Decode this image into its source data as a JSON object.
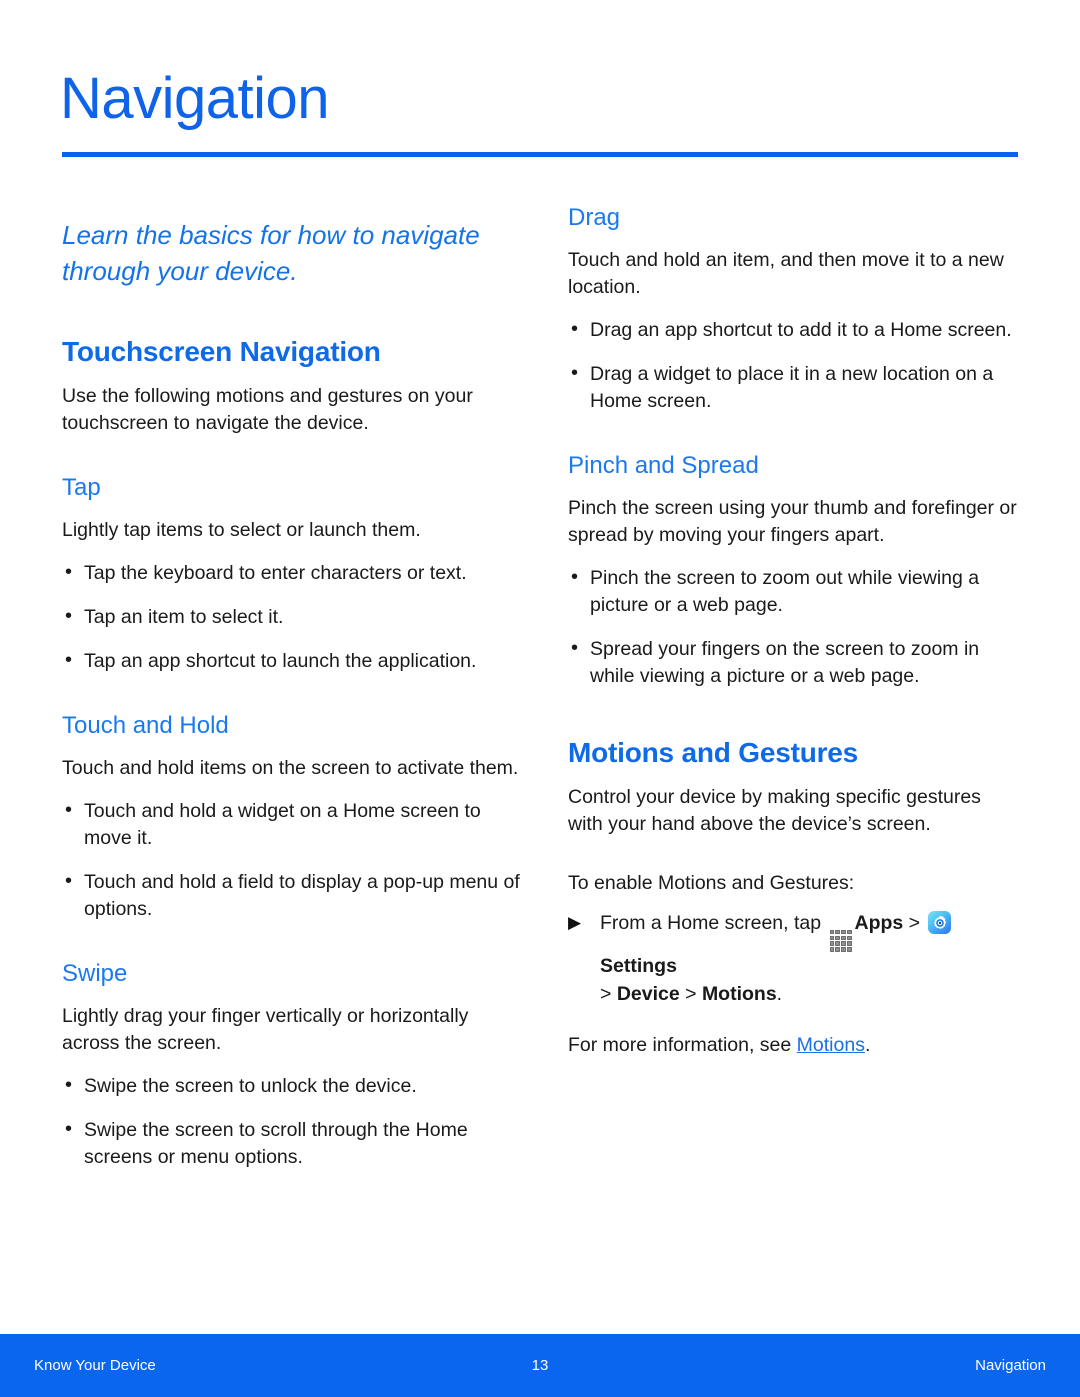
{
  "header": {
    "title": "Navigation",
    "rule_color": "#0a63ed"
  },
  "colors": {
    "accent_blue": "#0f63e8",
    "heading_blue": "#0f6ae8",
    "subheading_blue": "#1b79f0",
    "link_blue": "#1b6fe8",
    "footer_blue": "#0a66ee",
    "body_text": "#1a1a1a"
  },
  "left_column": {
    "intro": "Learn the basics for how to navigate through your device.",
    "section": {
      "title": "Touchscreen Navigation",
      "body": "Use the following motions and gestures on your touchscreen to navigate the device."
    },
    "subsections": [
      {
        "title": "Tap",
        "body": "Lightly tap items to select or launch them.",
        "bullets": [
          "Tap the keyboard to enter characters or text.",
          "Tap an item to select it.",
          "Tap an app shortcut to launch the application."
        ]
      },
      {
        "title": "Touch and Hold",
        "body": "Touch and hold items on the screen to activate them.",
        "bullets": [
          "Touch and hold a widget on a Home screen to move it.",
          "Touch and hold a field to display a pop-up menu of options."
        ]
      },
      {
        "title": "Swipe",
        "body": "Lightly drag your finger vertically or horizontally across the screen.",
        "bullets": [
          "Swipe the screen to unlock the device.",
          "Swipe the screen to scroll through the Home screens or menu options."
        ]
      }
    ]
  },
  "right_column": {
    "subsections": [
      {
        "title": "Drag",
        "body": "Touch and hold an item, and then move it to a new location.",
        "bullets": [
          "Drag an app shortcut to add it to a Home screen.",
          "Drag a widget to place it in a new location on a Home screen."
        ]
      },
      {
        "title": "Pinch and Spread",
        "body": "Pinch the screen using your thumb and forefinger or spread by moving your fingers apart.",
        "bullets": [
          "Pinch the screen to zoom out while viewing a picture or a web page.",
          "Spread your fingers on the screen to zoom in while viewing a picture or a web page."
        ]
      }
    ],
    "motions_section": {
      "title": "Motions and Gestures",
      "body": "Control your device by making specific gestures with your hand above the device’s screen.",
      "enable_intro": "To enable Motions and Gestures:",
      "step": {
        "prefix": "From a Home screen, tap ",
        "apps_icon_name": "apps-grid-icon",
        "apps_label": "Apps",
        "separator_1": " > ",
        "settings_icon_name": "settings-gear-icon",
        "settings_label": "Settings",
        "path_tail_prefix": "> ",
        "path_device": "Device",
        "path_separator": " > ",
        "path_motions": "Motions",
        "path_period": "."
      },
      "more_info_prefix": "For more information, see ",
      "more_info_link": "Motions",
      "more_info_suffix": "."
    }
  },
  "footer": {
    "left": "Know Your Device",
    "page_number": "13",
    "right": "Navigation"
  }
}
